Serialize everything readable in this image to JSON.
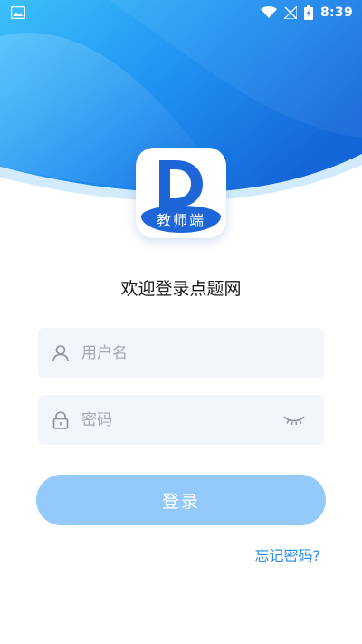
{
  "status_bar": {
    "time": "8:39",
    "icons": [
      "image-icon",
      "wifi-icon",
      "no-signal-icon",
      "battery-charging-icon"
    ]
  },
  "logo": {
    "letter": "D",
    "banner_text": "教师端"
  },
  "welcome_text": "欢迎登录点题网",
  "form": {
    "username": {
      "placeholder": "用户名",
      "value": ""
    },
    "password": {
      "placeholder": "密码",
      "value": ""
    }
  },
  "login_button": {
    "label": "登录"
  },
  "forgot_password": {
    "label": "忘记密码?"
  },
  "colors": {
    "brand_blue": "#1e66d8",
    "header_light": "#36b6f6",
    "button_disabled": "#93c9fb",
    "link": "#2a8bf0",
    "field_bg": "#f2f5fa"
  }
}
